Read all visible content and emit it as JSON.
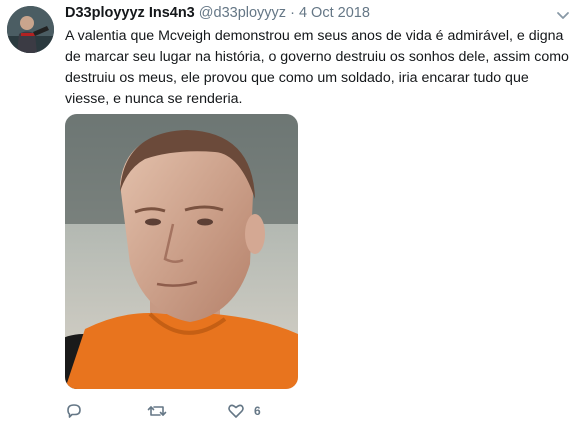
{
  "tweet": {
    "display_name": "D33ployyyz Ins4n3",
    "handle": "@d33ployyyz",
    "separator": "·",
    "date": "4 Oct 2018",
    "text": "A valentia que Mcveigh demonstrou em seus anos de vida é admirável, e digna de marcar seu lugar na história, o governo destruiu os sonhos dele, assim como destruiu os meus, ele provou que como um soldado, iria encarar tudo que viesse, e nunca se renderia.",
    "media": "photo-of-man-in-orange-shirt",
    "avatar": "user-avatar-photo"
  },
  "actions": {
    "reply_icon": "reply-icon",
    "retweet_icon": "retweet-icon",
    "like_icon": "like-icon",
    "like_count": "6"
  },
  "colors": {
    "text_primary": "#14171a",
    "text_secondary": "#657786",
    "shirt_orange": "#e8741e"
  }
}
